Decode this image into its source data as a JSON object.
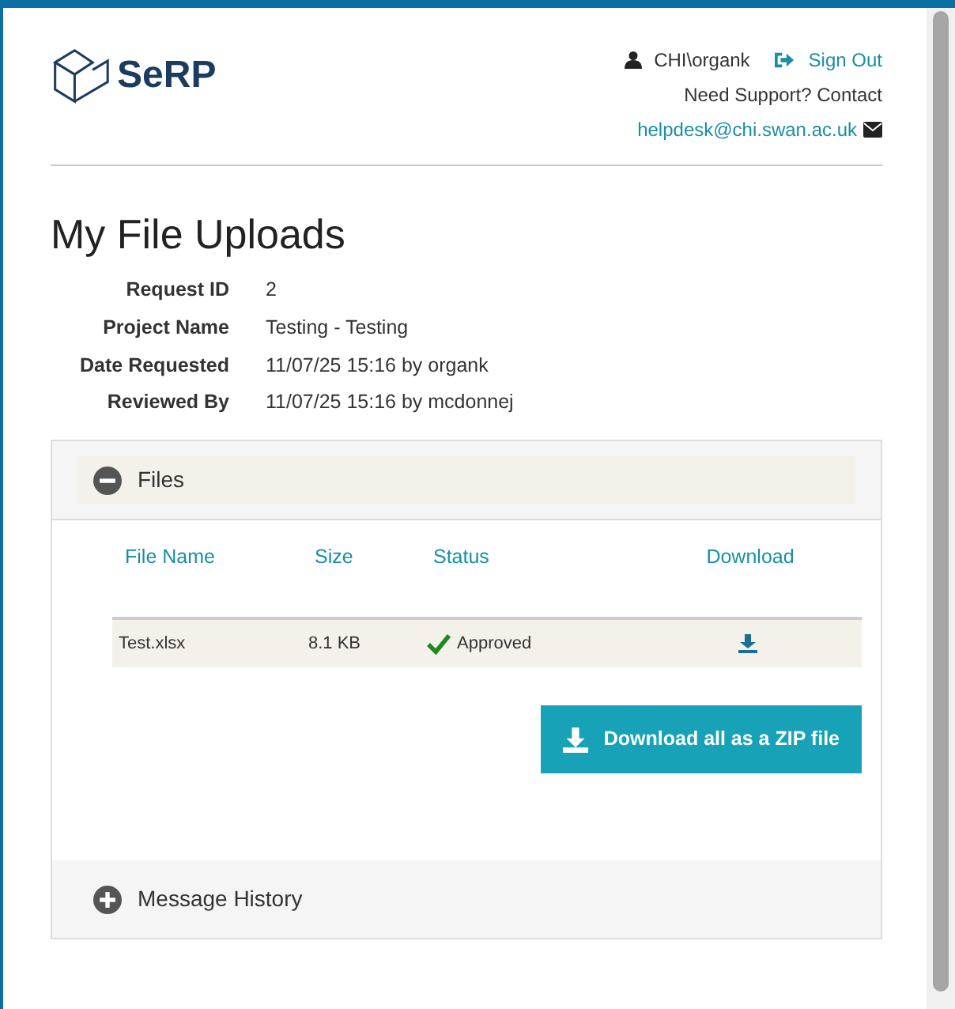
{
  "header": {
    "logo_text": "SeRP",
    "user": "CHI\\organk",
    "sign_out": "Sign Out",
    "support_text": "Need Support? Contact",
    "support_email": "helpdesk@chi.swan.ac.uk"
  },
  "title": "My File Uploads",
  "details": [
    {
      "label": "Request ID",
      "value": "2"
    },
    {
      "label": "Project Name",
      "value": "Testing - Testing"
    },
    {
      "label": "Date Requested",
      "value": "11/07/25 15:16 by organk"
    },
    {
      "label": "Reviewed By",
      "value": "11/07/25 15:16 by mcdonnej"
    }
  ],
  "panels": [
    {
      "title": "Files",
      "expanded": true,
      "table": {
        "columns": [
          "File Name",
          "Size",
          "Status",
          "Download"
        ],
        "rows": [
          {
            "file_name": "Test.xlsx",
            "size": "8.1 KB",
            "status": "Approved"
          }
        ]
      },
      "download_all_button": "Download all as a ZIP file"
    },
    {
      "title": "Message History",
      "expanded": false
    }
  ]
}
